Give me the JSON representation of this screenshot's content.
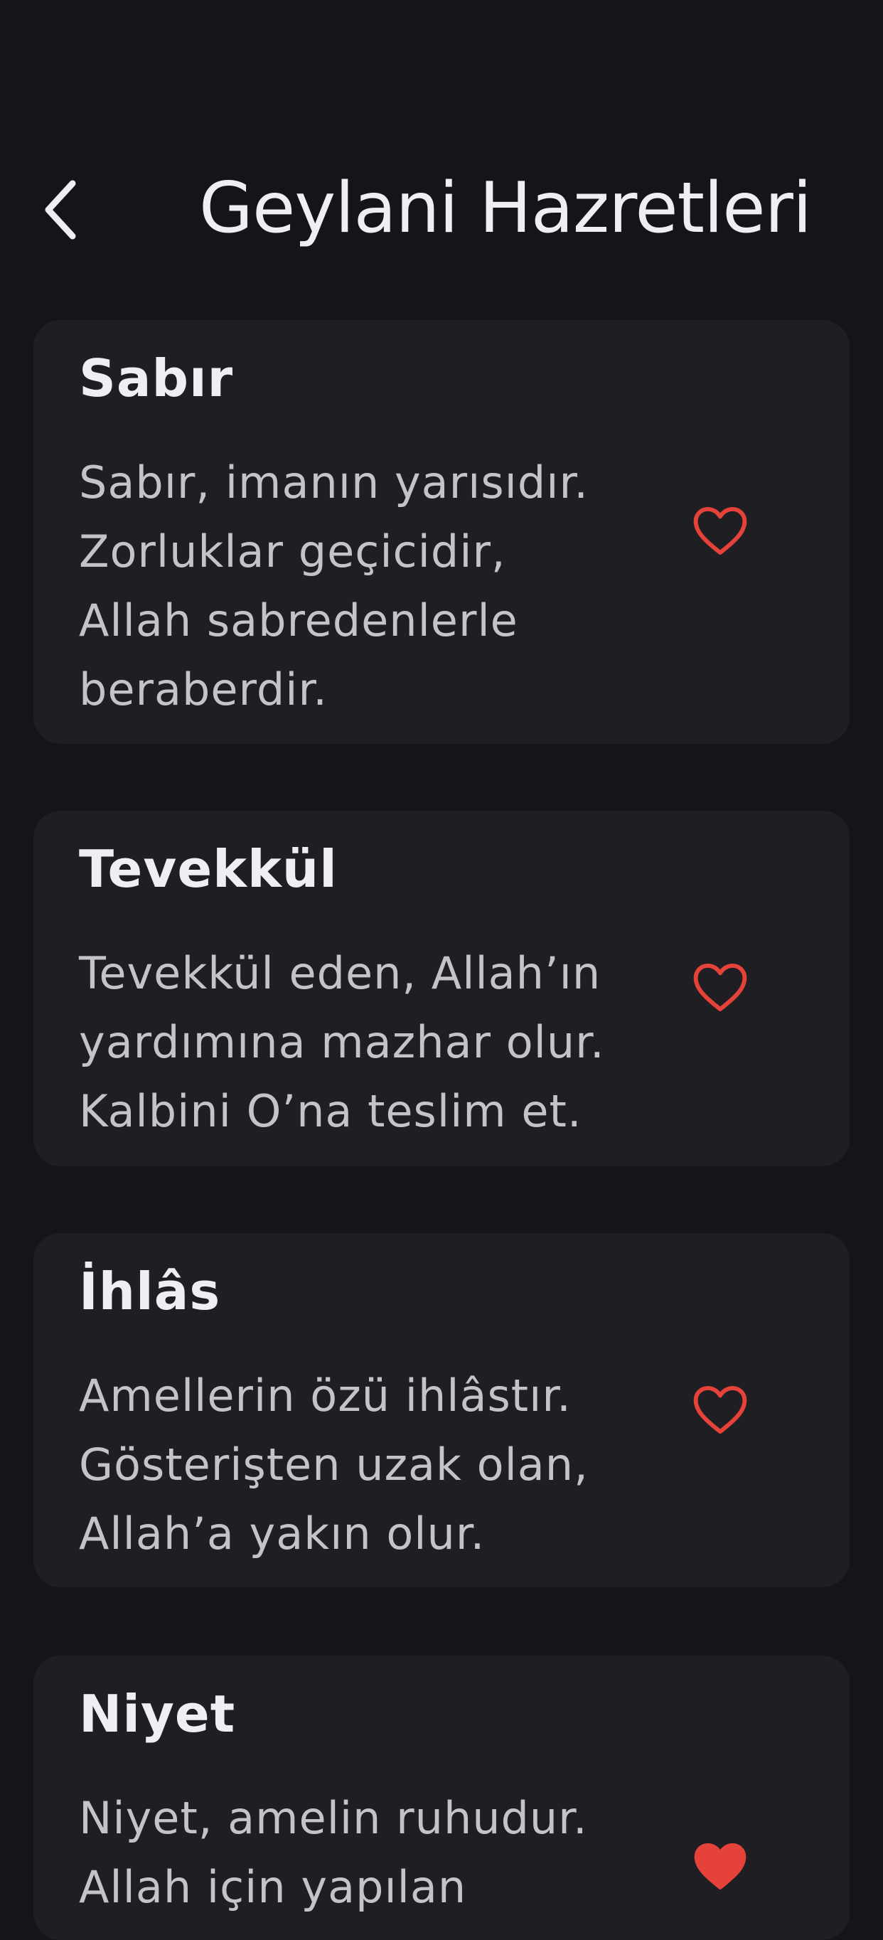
{
  "header": {
    "title": "Geylani Hazretleri ..."
  },
  "colors": {
    "background": "#151419",
    "card": "#1f1e23",
    "accent": "#e5433a"
  },
  "cards": [
    {
      "title": "Sabır",
      "text": "Sabır, imanın yarısıdır.\nZorluklar geçicidir,\nAllah sabredenlerle\nberaberdir.",
      "favorite": false,
      "icon": "heart-outline-icon"
    },
    {
      "title": "Tevekkül",
      "text": "Tevekkül eden, Allah’ın\nyardımına mazhar olur.\nKalbini O’na teslim et.",
      "favorite": false,
      "icon": "heart-outline-icon"
    },
    {
      "title": "İhlâs",
      "text": "Amellerin özü ihlâstır.\nGösterişten uzak olan,\nAllah’a yakın olur.",
      "favorite": false,
      "icon": "heart-outline-icon"
    },
    {
      "title": "Niyet",
      "text": "Niyet, amelin ruhudur.\nAllah için yapılan",
      "favorite": true,
      "icon": "heart-filled-icon"
    }
  ]
}
